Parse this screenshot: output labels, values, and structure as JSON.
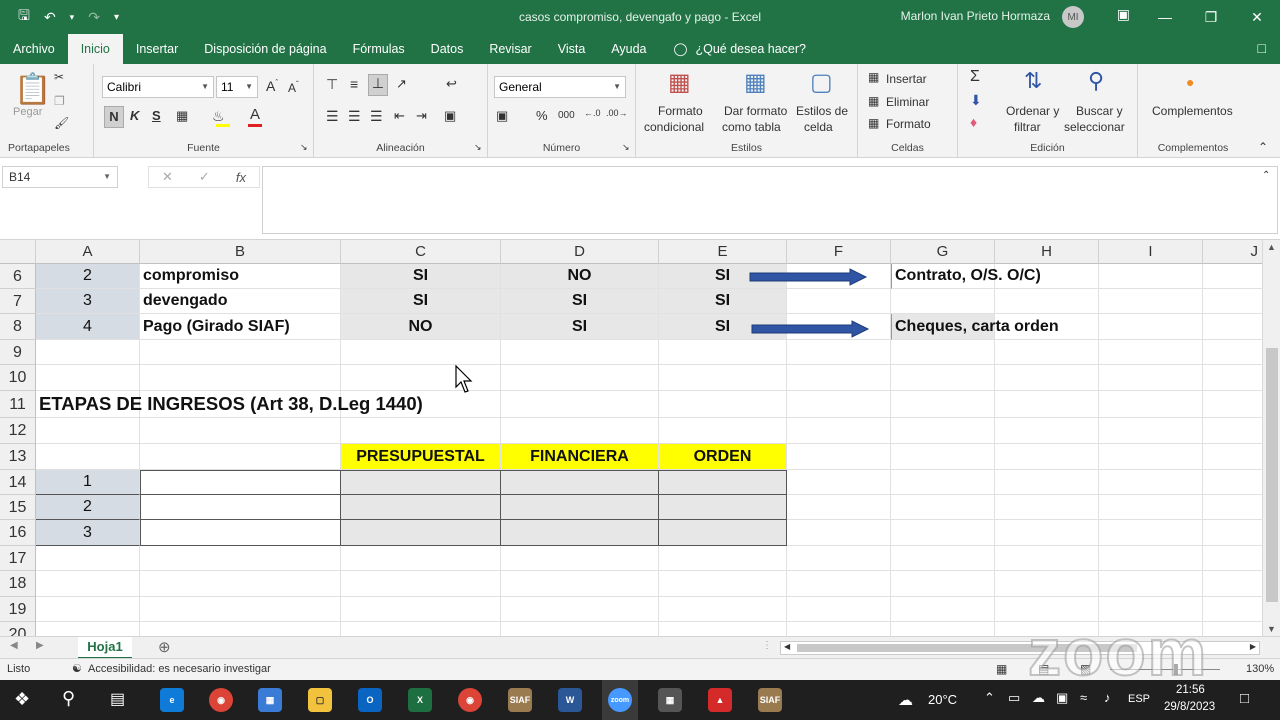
{
  "titlebar": {
    "doc_title": "casos  compromiso, devengafo y pago  -  Excel",
    "user_name": "Marlon Ivan Prieto Hormaza",
    "user_initials": "MI"
  },
  "tabs": [
    "Archivo",
    "Inicio",
    "Insertar",
    "Disposición de página",
    "Fórmulas",
    "Datos",
    "Revisar",
    "Vista",
    "Ayuda"
  ],
  "tell_me": "¿Qué desea hacer?",
  "ribbon": {
    "clipboard": {
      "paste": "Pegar",
      "label": "Portapapeles"
    },
    "font": {
      "name": "Calibri",
      "size": "11",
      "bold": "N",
      "italic": "K",
      "underline": "S",
      "label": "Fuente"
    },
    "alignment": {
      "label": "Alineación"
    },
    "number": {
      "format": "General",
      "label": "Número"
    },
    "styles": {
      "cond_format_1": "Formato",
      "cond_format_2": "condicional",
      "table_format_1": "Dar formato",
      "table_format_2": "como tabla",
      "cell_styles_1": "Estilos de",
      "cell_styles_2": "celda",
      "label": "Estilos"
    },
    "cells": {
      "insert": "Insertar",
      "delete": "Eliminar",
      "format": "Formato",
      "label": "Celdas"
    },
    "editing": {
      "sort_1": "Ordenar y",
      "sort_2": "filtrar",
      "find_1": "Buscar y",
      "find_2": "seleccionar",
      "label": "Edición"
    },
    "addins": {
      "button": "Complementos",
      "label": "Complementos"
    }
  },
  "formula_bar": {
    "name_box": "B14",
    "formula": ""
  },
  "columns": [
    "A",
    "B",
    "C",
    "D",
    "E",
    "F",
    "G",
    "H",
    "I",
    "J"
  ],
  "rows": [
    "6",
    "7",
    "8",
    "9",
    "10",
    "11",
    "12",
    "13",
    "14",
    "15",
    "16",
    "17",
    "18",
    "19",
    "20"
  ],
  "cells": {
    "r6": {
      "a": "2",
      "b": "compromiso",
      "c": "SI",
      "d": "NO",
      "e": "SI",
      "g": "Contrato, O/S. O/C)"
    },
    "r7": {
      "a": "3",
      "b": "devengado",
      "c": "SI",
      "d": "SI",
      "e": "SI"
    },
    "r8": {
      "a": "4",
      "b": "Pago (Girado SIAF)",
      "c": "NO",
      "d": "SI",
      "e": "SI",
      "g": "Cheques, carta orden"
    },
    "r11": {
      "a": "ETAPAS DE INGRESOS (Art 38, D.Leg 1440)"
    },
    "r13": {
      "c": "PRESUPUESTAL",
      "d": "FINANCIERA",
      "e": "ORDEN"
    },
    "r14": {
      "a": "1"
    },
    "r15": {
      "a": "2"
    },
    "r16": {
      "a": "3"
    }
  },
  "sheet_tab": "Hoja1",
  "status": {
    "ready": "Listo",
    "accessibility": "Accesibilidad: es necesario investigar",
    "zoom": "130%"
  },
  "taskbar": {
    "temp": "20°C",
    "lang": "ESP",
    "time": "21:56",
    "date": "29/8/2023",
    "siaf_label": "SIAF",
    "zoom_label": "zoom"
  },
  "watermark": "zoom",
  "colors": {
    "excel_green": "#217346",
    "header_yellow": "#ffff00",
    "arrow_blue": "#2f55a4"
  }
}
